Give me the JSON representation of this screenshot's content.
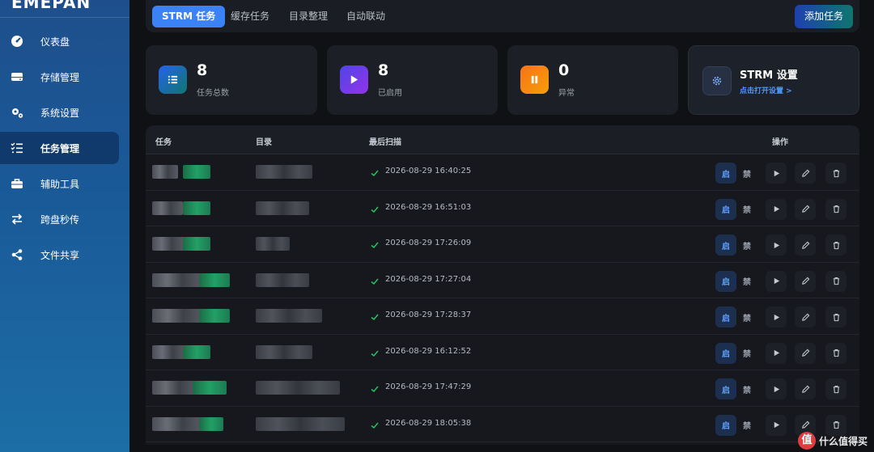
{
  "brand": "EMEPAN",
  "sidebar": {
    "items": [
      {
        "icon": "dashboard-icon",
        "label": "仪表盘"
      },
      {
        "icon": "storage-icon",
        "label": "存储管理"
      },
      {
        "icon": "gears-icon",
        "label": "系统设置"
      },
      {
        "icon": "task-list-icon",
        "label": "任务管理",
        "active": true
      },
      {
        "icon": "toolbox-icon",
        "label": "辅助工具"
      },
      {
        "icon": "transfer-arrows-icon",
        "label": "跨盘秒传"
      },
      {
        "icon": "share-icon",
        "label": "文件共享"
      }
    ]
  },
  "tabs": [
    {
      "label": "STRM 任务",
      "active": true
    },
    {
      "label": "缓存任务"
    },
    {
      "label": "目录整理"
    },
    {
      "label": "自动联动"
    }
  ],
  "add_button": "添加任务",
  "stats": [
    {
      "value": "8",
      "label": "任务总数",
      "icon": "list-icon",
      "color": "#2563eb"
    },
    {
      "value": "8",
      "label": "已启用",
      "icon": "play-icon",
      "color": "#7c3aed"
    },
    {
      "value": "0",
      "label": "异常",
      "icon": "pause-icon",
      "color": "#f59e0b"
    }
  ],
  "settings_card": {
    "title": "STRM 设置",
    "link": "点击打开设置 >",
    "icon": "gear-icon"
  },
  "table": {
    "columns": [
      "任务",
      "目录",
      "最后扫描",
      "操作"
    ],
    "action_labels": {
      "enable": "启",
      "disable": "禁"
    },
    "rows": [
      {
        "last_scan": "2026-08-29 16:40:25"
      },
      {
        "last_scan": "2026-08-29 16:51:03"
      },
      {
        "last_scan": "2026-08-29 17:26:09"
      },
      {
        "last_scan": "2026-08-29 17:27:04"
      },
      {
        "last_scan": "2026-08-29 17:28:37"
      },
      {
        "last_scan": "2026-08-29 16:12:52"
      },
      {
        "last_scan": "2026-08-29 17:47:29"
      },
      {
        "last_scan": "2026-08-29 18:05:38"
      }
    ]
  },
  "watermark": {
    "logo": "值",
    "text": "什么值得买"
  }
}
